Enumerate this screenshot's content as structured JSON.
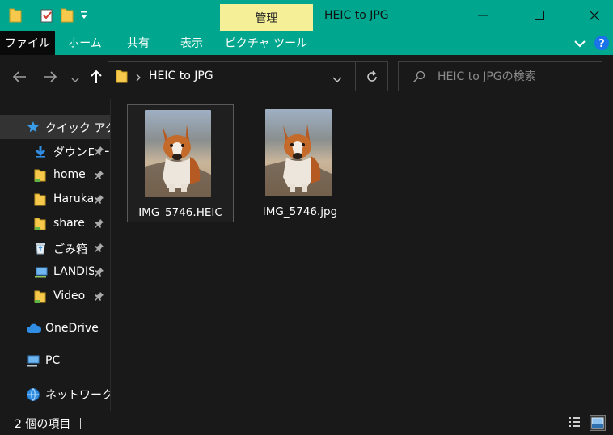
{
  "titlebar": {
    "contextual_tab": "管理",
    "window_title": "HEIC to JPG",
    "bg_color": "#00a78e",
    "contextual_color": "#f5f097"
  },
  "ribbon": {
    "tabs": [
      {
        "label": "ファイル",
        "active": true
      },
      {
        "label": "ホーム"
      },
      {
        "label": "共有"
      },
      {
        "label": "表示"
      },
      {
        "label": "ピクチャ ツール"
      }
    ]
  },
  "address": {
    "path": "HEIC to JPG",
    "search_placeholder": "HEIC to JPGの検索"
  },
  "navpane": {
    "quick_access": "クイック アクセス",
    "items": [
      {
        "label": "ダウンロード",
        "icon": "download-icon",
        "pinned": true
      },
      {
        "label": "home",
        "icon": "folder-icon",
        "pinned": true
      },
      {
        "label": "Haruka",
        "icon": "folder-icon",
        "pinned": true
      },
      {
        "label": "share",
        "icon": "folder-icon",
        "pinned": true
      },
      {
        "label": "ごみ箱",
        "icon": "recycle-bin-icon",
        "pinned": true
      },
      {
        "label": "LANDISK",
        "icon": "network-drive-icon",
        "pinned": true
      },
      {
        "label": "Video",
        "icon": "folder-icon",
        "pinned": true
      }
    ],
    "onedrive": "OneDrive",
    "pc": "PC",
    "network": "ネットワーク"
  },
  "files": [
    {
      "name": "IMG_5746.HEIC",
      "selected": true
    },
    {
      "name": "IMG_5746.jpg",
      "selected": false
    }
  ],
  "status": {
    "count_text": "2 個の項目"
  }
}
